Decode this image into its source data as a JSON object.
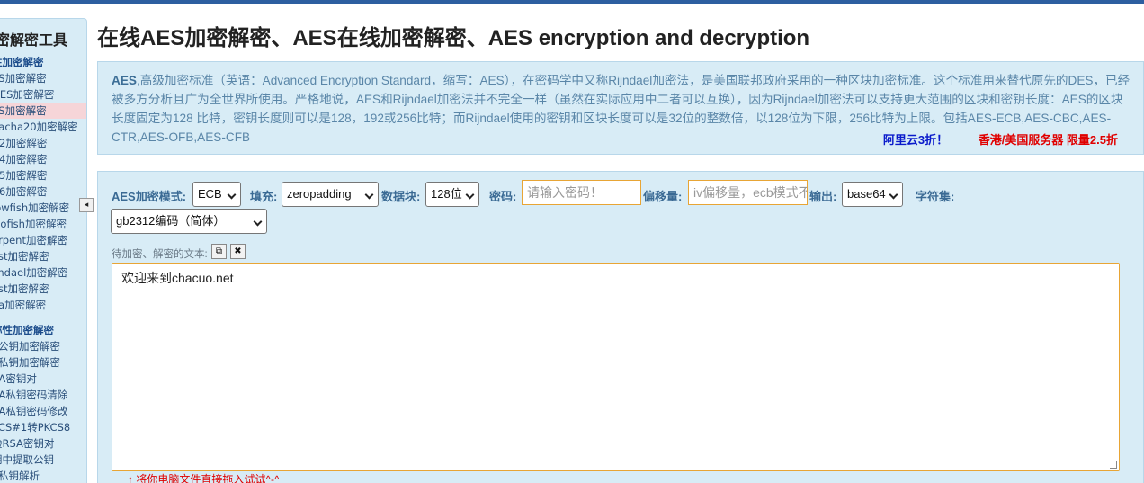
{
  "sidebar": {
    "title": "密解密工具",
    "items": [
      {
        "label": "性加密解密",
        "kind": "head"
      },
      {
        "label": "ES加密解密",
        "kind": "item"
      },
      {
        "label": "DES加密解密",
        "kind": "item"
      },
      {
        "label": "ES加密解密",
        "kind": "active"
      },
      {
        "label": "hacha20加密解密",
        "kind": "item"
      },
      {
        "label": "C2加密解密",
        "kind": "item"
      },
      {
        "label": "C4加密解密",
        "kind": "item"
      },
      {
        "label": "C5加密解密",
        "kind": "item"
      },
      {
        "label": "C6加密解密",
        "kind": "item"
      },
      {
        "label": "lowfish加密解密",
        "kind": "item"
      },
      {
        "label": "wofish加密解密",
        "kind": "item"
      },
      {
        "label": "erpent加密解密",
        "kind": "item"
      },
      {
        "label": "ost加密解密",
        "kind": "item"
      },
      {
        "label": "ijndael加密解密",
        "kind": "item"
      },
      {
        "label": "ast加密解密",
        "kind": "item"
      },
      {
        "label": "ea加密解密",
        "kind": "item"
      },
      {
        "label": "",
        "kind": "spacer"
      },
      {
        "label": "称性加密解密",
        "kind": "head"
      },
      {
        "label": "a公钥加密解密",
        "kind": "item"
      },
      {
        "label": "a私钥加密解密",
        "kind": "item"
      },
      {
        "label": "SA密钥对",
        "kind": "item"
      },
      {
        "label": "SA私钥密码清除",
        "kind": "item"
      },
      {
        "label": "SA私钥密码修改",
        "kind": "item"
      },
      {
        "label": "KCS#1转PKCS8",
        "kind": "item"
      },
      {
        "label": "验RSA密钥对",
        "kind": "item"
      },
      {
        "label": "钥中提取公钥",
        "kind": "item"
      },
      {
        "label": "a私钥解析",
        "kind": "item"
      }
    ],
    "collapse_icon": "◂"
  },
  "page": {
    "title": "在线AES加密解密、AES在线加密解密、AES encryption and decryption"
  },
  "description": {
    "lead": "AES",
    "text": ",高级加密标准（英语：Advanced Encryption Standard，缩写：AES），在密码学中又称Rijndael加密法，是美国联邦政府采用的一种区块加密标准。这个标准用来替代原先的DES，已经被多方分析且广为全世界所使用。严格地说，AES和Rijndael加密法并不完全一样（虽然在实际应用中二者可以互换），因为Rijndael加密法可以支持更大范围的区块和密钥长度：AES的区块长度固定为128 比特，密钥长度则可以是128，192或256比特；而Rijndael使用的密钥和区块长度可以是32位的整数倍，以128位为下限，256比特为上限。包括AES-ECB,AES-CBC,AES-CTR,AES-OFB,AES-CFB",
    "link_aliyun": "阿里云3折！",
    "link_hk": "香港/美国服务器 限量2.5折"
  },
  "form": {
    "mode_label": "AES加密模式:",
    "mode_value": "ECB",
    "padding_label": "填充:",
    "padding_value": "zeropadding",
    "block_label": "数据块:",
    "block_value": "128位",
    "password_label": "密码:",
    "password_placeholder": "请输入密码！",
    "iv_label": "偏移量:",
    "iv_placeholder": "iv偏移量，ecb模式不用填写！",
    "output_label": "输出:",
    "output_value": "base64",
    "charset_label": "字符集:",
    "charset_value": "gb2312编码（简体）",
    "text_label": "待加密、解密的文本:",
    "copy_icon": "⧉",
    "clear_icon": "✖",
    "text_value": "欢迎来到chacuo.net",
    "hint": "↑ 将你电脑文件直接拖入试试^-^"
  }
}
